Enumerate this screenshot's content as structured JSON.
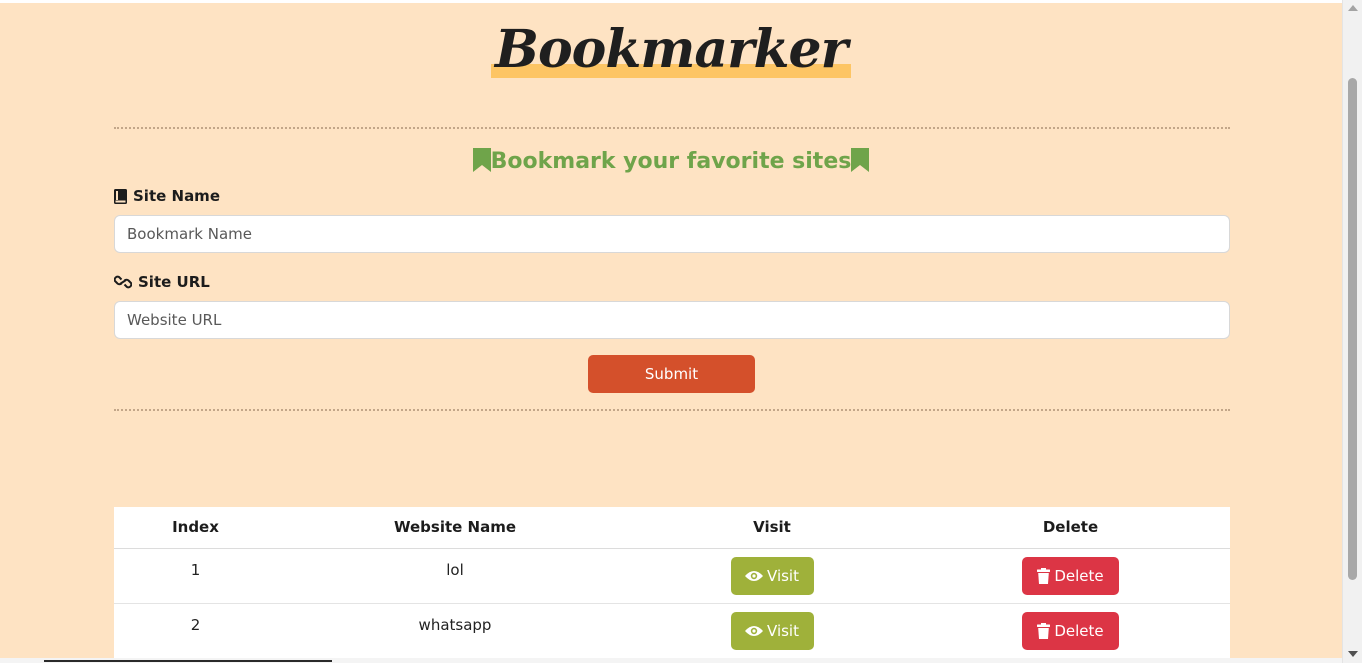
{
  "brand": {
    "title": "Bookmarker"
  },
  "form": {
    "heading": "Bookmark your favorite sites",
    "site_name": {
      "label": "Site Name",
      "placeholder": "Bookmark Name",
      "icon": "book-icon"
    },
    "site_url": {
      "label": "Site URL",
      "placeholder": "Website URL",
      "icon": "link-icon"
    },
    "submit_label": "Submit"
  },
  "table": {
    "headers": [
      "Index",
      "Website Name",
      "Visit",
      "Delete"
    ],
    "rows": [
      {
        "index": "1",
        "name": "lol",
        "visit_label": "Visit",
        "delete_label": "Delete"
      },
      {
        "index": "2",
        "name": "whatsapp",
        "visit_label": "Visit",
        "delete_label": "Delete"
      }
    ]
  },
  "colors": {
    "background": "#fee3c3",
    "heading_green": "#6fa44a",
    "submit": "#d4502b",
    "visit": "#9fb13a",
    "delete": "#dc3545",
    "brand_highlight": "#fdc564"
  }
}
